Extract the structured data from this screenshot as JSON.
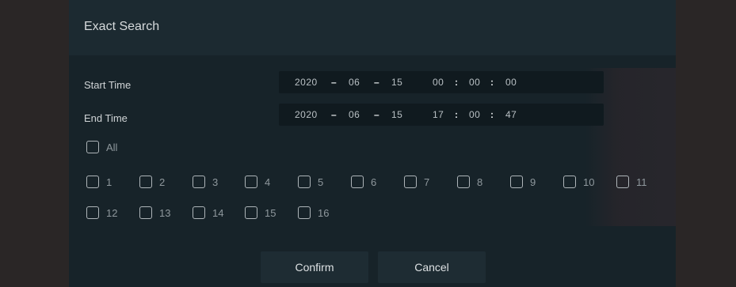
{
  "dialog": {
    "title": "Exact Search"
  },
  "start_time": {
    "label": "Start Time",
    "year": "2020",
    "month": "06",
    "day": "15",
    "hour": "00",
    "minute": "00",
    "second": "00"
  },
  "end_time": {
    "label": "End Time",
    "year": "2020",
    "month": "06",
    "day": "15",
    "hour": "17",
    "minute": "00",
    "second": "47"
  },
  "separators": {
    "date": "–",
    "time": ":"
  },
  "channels": {
    "all_label": "All",
    "items": [
      "1",
      "2",
      "3",
      "4",
      "5",
      "6",
      "7",
      "8",
      "9",
      "10",
      "11",
      "12",
      "13",
      "14",
      "15",
      "16"
    ]
  },
  "buttons": {
    "confirm": "Confirm",
    "cancel": "Cancel"
  }
}
